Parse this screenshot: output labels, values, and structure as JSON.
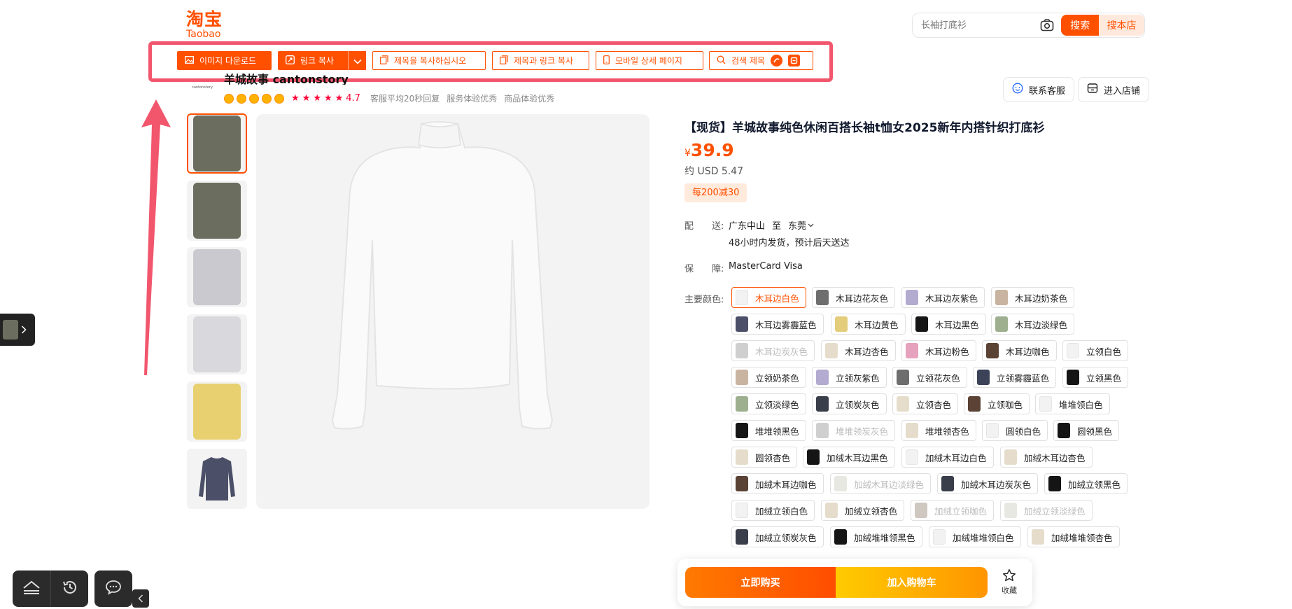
{
  "logo": {
    "cn": "淘宝",
    "en": "Taobao"
  },
  "search": {
    "placeholder": "长袖打底衫",
    "search_label": "搜索",
    "shop_label": "搜本店"
  },
  "toolbar": {
    "download_image": "이미지 다운로드",
    "copy_link": "링크 복사",
    "copy_title": "제목을 복사하십시오",
    "copy_title_link": "제목과 링크 복사",
    "mobile_detail": "모바일 상세 페이지",
    "search_title": "검색 제목"
  },
  "shop": {
    "name": "羊城故事 cantonstory",
    "logo_text": "cantonstory",
    "rating": "4.7",
    "metrics": [
      "客服平均20秒回复",
      "服务体验优秀",
      "商品体验优秀"
    ],
    "contact_label": "联系客服",
    "enter_label": "进入店铺"
  },
  "product": {
    "title": "【现货】羊城故事纯色休闲百搭长袖t恤女2025新年内搭针织打底衫",
    "currency": "¥",
    "price": "39.9",
    "usd": "约 USD 5.47",
    "promo": "每200减30",
    "ship_label": "配　　送:",
    "ship_from": "广东中山",
    "ship_to_word": "至",
    "ship_to": "东莞",
    "ship_note": "48小时内发货，预计后天送达",
    "guarantee_label": "保　　障:",
    "guarantee": "MasterCard Visa",
    "color_label": "主要颜色:"
  },
  "colors": [
    {
      "label": "木耳边白色",
      "swatch": "#f2f2f2",
      "state": "selected"
    },
    {
      "label": "木耳边花灰色",
      "swatch": "#6e6e6e",
      "state": "normal"
    },
    {
      "label": "木耳边灰紫色",
      "swatch": "#b3abd0",
      "state": "normal"
    },
    {
      "label": "木耳边奶茶色",
      "swatch": "#c8b4a0",
      "state": "normal"
    },
    {
      "label": "木耳边雾霾蓝色",
      "swatch": "#4b5068",
      "state": "normal"
    },
    {
      "label": "木耳边黄色",
      "swatch": "#e3cd7a",
      "state": "normal"
    },
    {
      "label": "木耳边黑色",
      "swatch": "#151515",
      "state": "normal"
    },
    {
      "label": "木耳边淡绿色",
      "swatch": "#9eaf90",
      "state": "normal"
    },
    {
      "label": "木耳边炭灰色",
      "swatch": "#cfcfcf",
      "state": "disabled"
    },
    {
      "label": "木耳边杏色",
      "swatch": "#e6dccb",
      "state": "normal"
    },
    {
      "label": "木耳边粉色",
      "swatch": "#e6a1bd",
      "state": "normal"
    },
    {
      "label": "木耳边咖色",
      "swatch": "#5a4234",
      "state": "normal"
    },
    {
      "label": "立领白色",
      "swatch": "#f2f2f2",
      "state": "normal"
    },
    {
      "label": "立领奶茶色",
      "swatch": "#c8b4a0",
      "state": "normal"
    },
    {
      "label": "立领灰紫色",
      "swatch": "#b3abd0",
      "state": "normal"
    },
    {
      "label": "立领花灰色",
      "swatch": "#6e6e6e",
      "state": "normal"
    },
    {
      "label": "立领雾霾蓝色",
      "swatch": "#3c4258",
      "state": "normal"
    },
    {
      "label": "立领黑色",
      "swatch": "#151515",
      "state": "normal"
    },
    {
      "label": "立领淡绿色",
      "swatch": "#9eaf90",
      "state": "normal"
    },
    {
      "label": "立领炭灰色",
      "swatch": "#3a3d4a",
      "state": "normal"
    },
    {
      "label": "立领杏色",
      "swatch": "#e6dccb",
      "state": "normal"
    },
    {
      "label": "立领咖色",
      "swatch": "#5a4234",
      "state": "normal"
    },
    {
      "label": "堆堆领白色",
      "swatch": "#f2f2f2",
      "state": "normal"
    },
    {
      "label": "堆堆领黑色",
      "swatch": "#151515",
      "state": "normal"
    },
    {
      "label": "堆堆领炭灰色",
      "swatch": "#cfcfcf",
      "state": "disabled"
    },
    {
      "label": "堆堆领杏色",
      "swatch": "#e6dccb",
      "state": "normal"
    },
    {
      "label": "圆领白色",
      "swatch": "#f2f2f2",
      "state": "normal"
    },
    {
      "label": "圆领黑色",
      "swatch": "#151515",
      "state": "normal"
    },
    {
      "label": "圆领杏色",
      "swatch": "#e6dccb",
      "state": "normal"
    },
    {
      "label": "加绒木耳边黑色",
      "swatch": "#151515",
      "state": "normal"
    },
    {
      "label": "加绒木耳边白色",
      "swatch": "#f2f2f2",
      "state": "normal"
    },
    {
      "label": "加绒木耳边杏色",
      "swatch": "#e6dccb",
      "state": "normal"
    },
    {
      "label": "加绒木耳边咖色",
      "swatch": "#5a4234",
      "state": "normal"
    },
    {
      "label": "加绒木耳边淡绿色",
      "swatch": "#e8e8e2",
      "state": "disabled"
    },
    {
      "label": "加绒木耳边炭灰色",
      "swatch": "#3a3d4a",
      "state": "normal"
    },
    {
      "label": "加绒立领黑色",
      "swatch": "#151515",
      "state": "normal"
    },
    {
      "label": "加绒立领白色",
      "swatch": "#f2f2f2",
      "state": "normal"
    },
    {
      "label": "加绒立领杏色",
      "swatch": "#e6dccb",
      "state": "normal"
    },
    {
      "label": "加绒立领咖色",
      "swatch": "#cfc8c0",
      "state": "disabled"
    },
    {
      "label": "加绒立领淡绿色",
      "swatch": "#e8e8e2",
      "state": "disabled"
    },
    {
      "label": "加绒立领炭灰色",
      "swatch": "#3a3d4a",
      "state": "normal"
    },
    {
      "label": "加绒堆堆领黑色",
      "swatch": "#151515",
      "state": "normal"
    },
    {
      "label": "加绒堆堆领白色",
      "swatch": "#f2f2f2",
      "state": "normal"
    },
    {
      "label": "加绒堆堆领杏色",
      "swatch": "#e6dccb",
      "state": "normal"
    }
  ],
  "thumbnails": [
    {
      "name": "thumb-1",
      "color": "#6b6e5e"
    },
    {
      "name": "thumb-2",
      "color": "#6b6e5e"
    },
    {
      "name": "thumb-3",
      "color": "#c9c9cf"
    },
    {
      "name": "thumb-4",
      "color": "#d9d9dd"
    },
    {
      "name": "thumb-5",
      "color": "#e8d070"
    },
    {
      "name": "thumb-6",
      "color": "#4b5068"
    }
  ],
  "actions": {
    "buy_now": "立即购买",
    "add_cart": "加入购物车",
    "favorite": "收藏"
  },
  "theme": {
    "accent": "#ff5000",
    "highlight": "#f2566d"
  }
}
